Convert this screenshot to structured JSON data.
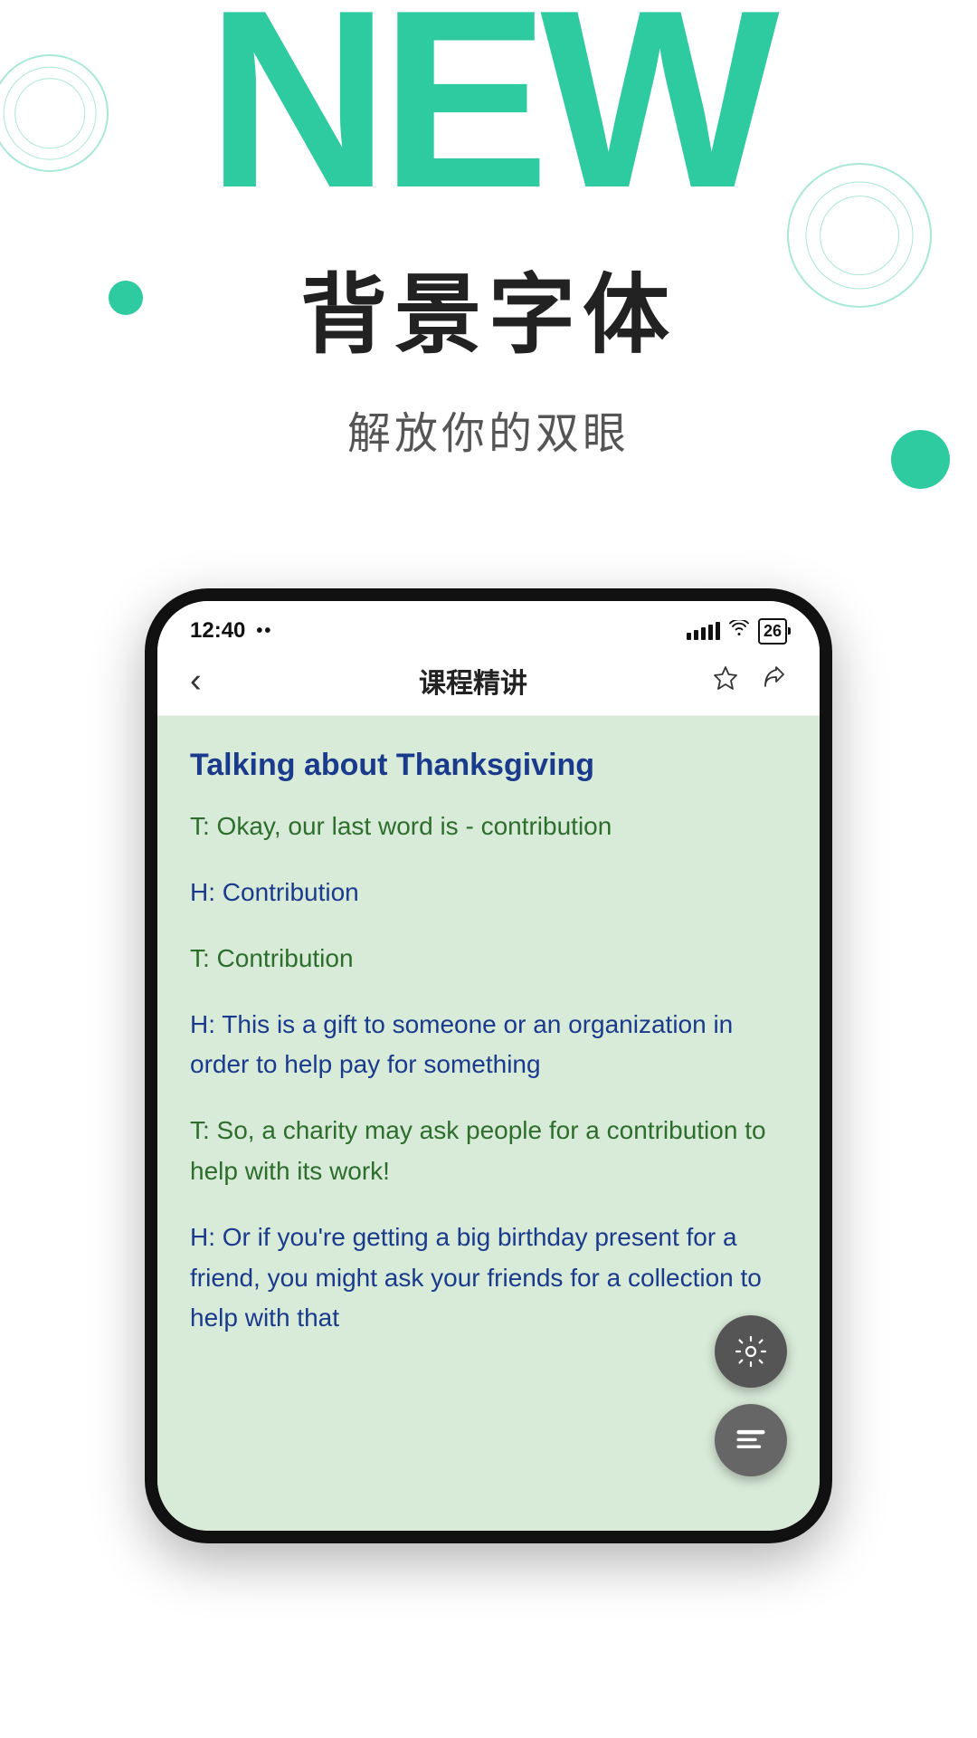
{
  "header": {
    "new_text": "NEW",
    "main_title_zh": "背景字体",
    "subtitle_zh": "解放你的双眼"
  },
  "status_bar": {
    "time": "12:40",
    "dots": "••",
    "battery": "26"
  },
  "nav": {
    "back_icon": "‹",
    "title": "课程精讲",
    "star_icon": "☆",
    "share_icon": "↺"
  },
  "content": {
    "lesson_title": "Talking about Thanksgiving",
    "dialogues": [
      {
        "speaker": "T",
        "text": "T: Okay, our last word is - contribution",
        "type": "T"
      },
      {
        "speaker": "H",
        "text": "H: Contribution",
        "type": "H"
      },
      {
        "speaker": "T",
        "text": "T: Contribution",
        "type": "T"
      },
      {
        "speaker": "H",
        "text": "H: This is a gift to someone or an organization in order to help pay for something",
        "type": "H"
      },
      {
        "speaker": "T",
        "text": "T: So, a charity may ask people for a contribution to help with its work!",
        "type": "T"
      },
      {
        "speaker": "H",
        "text": "H: Or if you're getting a big birthday present for a friend, you might ask your friends for a collection to help with that",
        "type": "H"
      }
    ]
  },
  "fab": {
    "settings_icon": "settings",
    "text_icon": "text"
  }
}
